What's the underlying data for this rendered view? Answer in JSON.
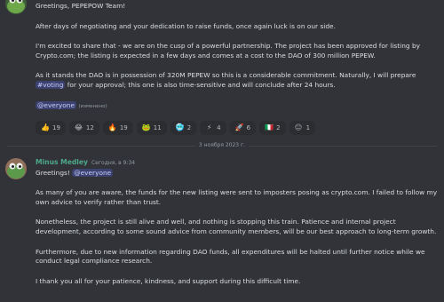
{
  "message1": {
    "line_greeting": "Greetings, PEPEPOW Team!",
    "para1": "After days of negotiating and your dedication to raise funds, once again luck is on our side.",
    "para2": "I'm excited to share that - we are on the cusp of a powerful partnership. The project has been approved for listing by Crypto.com; the listing is expected in a few days and comes at a cost to the DAO of 300 million PEPEW.",
    "para3_before": "As it stands the DAO is in possession of 320M PEPEW so this is a considerable commitment. Naturally, I will prepare ",
    "para3_channel": "#voting",
    "para3_after": " for your approval; this one is also time-sensitive and will conclude after 24 hours.",
    "mention": "@everyone",
    "edited": "(изменено)",
    "reactions": [
      {
        "emoji": "👍",
        "count": "19"
      },
      {
        "emoji": "😂",
        "count": "12"
      },
      {
        "emoji": "🔥",
        "count": "19"
      },
      {
        "emoji": "🐸",
        "count": "11"
      },
      {
        "emoji": "🥶",
        "count": "2"
      },
      {
        "emoji": "⚡",
        "count": "4"
      },
      {
        "emoji": "🚀",
        "count": "6"
      },
      {
        "emoji": "🇮🇹",
        "count": "2"
      },
      {
        "emoji": "😐",
        "count": "1"
      }
    ]
  },
  "divider": {
    "date": "3 ноября 2023 г."
  },
  "message2": {
    "username": "Minus Medley",
    "timestamp": "Сегодня, в 9:34",
    "greeting": "Greetings!",
    "mention": "@everyone",
    "para1": "As many of you are aware, the funds for the new listing were sent to imposters posing as crypto.com. I failed to follow my own advice to verify rather than trust.",
    "para2": "Nonetheless, the project is still alive and well, and nothing is stopping this train. Patience and internal project development, according to some sound advice from community members, will be our best approach to long-term growth.",
    "para3": "Furthermore, due to new information regarding DAO funds, all expenditures will be halted until further notice while we conduct legal compliance research.",
    "para4": "I thank you all for your patience, kindness, and support during this difficult time."
  },
  "colors": {
    "background": "#313338",
    "username": "#4ea88a",
    "mention_bg": "#3c4270",
    "mention_text": "#c9cdfb"
  }
}
